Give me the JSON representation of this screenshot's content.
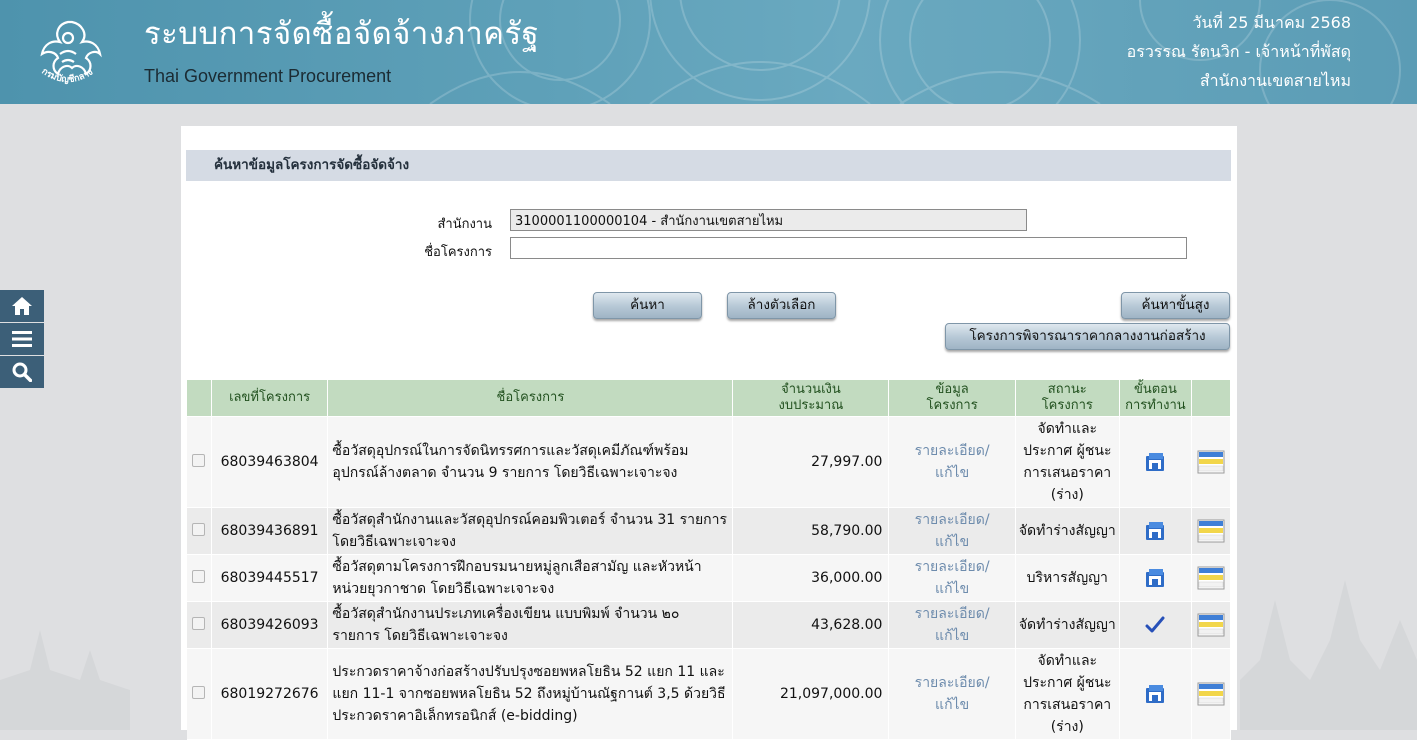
{
  "header": {
    "title_th": "ระบบการจัดซื้อจัดจ้างภาครัฐ",
    "title_en": "Thai Government Procurement",
    "date": "วันที่ 25 มีนาคม 2568",
    "user": "อรวรรณ รัตนวิก - เจ้าหน้าที่พัสดุ",
    "office": "สำนักงานเขตสายไหม",
    "logo_text": "กรมบัญชีกลาง"
  },
  "sidenav": [
    "home-icon",
    "menu-icon",
    "search-icon"
  ],
  "search": {
    "section_title": "ค้นหาข้อมูลโครงการจัดซื้อจัดจ้าง",
    "office_label": "สำนักงาน",
    "office_value": "3100001100000104 - สำนักงานเขตสายไหม",
    "project_label": "ชื่อโครงการ",
    "project_value": "",
    "search_button": "ค้นหา",
    "clear_button": "ล้างตัวเลือก",
    "advanced_button": "ค้นหาขั้นสูง",
    "median_price_button": "โครงการพิจารณาราคากลางงานก่อสร้าง"
  },
  "table": {
    "headers": {
      "number": "เลขที่โครงการ",
      "name": "ชื่อโครงการ",
      "budget_1": "จำนวนเงิน",
      "budget_2": "งบประมาณ",
      "info_1": "ข้อมูล",
      "info_2": "โครงการ",
      "status_1": "สถานะ",
      "status_2": "โครงการ",
      "step_1": "ขั้นตอน",
      "step_2": "การทำงาน"
    },
    "detail_link_1": "รายละเอียด/",
    "detail_link_2": "แก้ไข",
    "rows": [
      {
        "number": "68039463804",
        "name_1": " ซื้อวัสดุอุปกรณ์ในการจัดนิทรรศการและวัสดุเคมีภัณฑ์พร้อม",
        "name_2": "อุปกรณ์ล้างตลาด จำนวน 9 รายการ โดยวิธีเฉพาะเจาะจง",
        "name_3": "",
        "amount": "27,997.00",
        "status_1": "จัดทำและ",
        "status_2": "ประกาศ ผู้ชนะ",
        "status_3": "การเสนอราคา",
        "status_4": "(ร่าง)",
        "step_icon": "work-step-icon"
      },
      {
        "number": "68039436891",
        "name_1": " ซื้อวัสดุสำนักงานและวัสดุอุปกรณ์คอมพิวเตอร์ จำนวน 31 รายการ",
        "name_2": "โดยวิธีเฉพาะเจาะจง",
        "name_3": "",
        "amount": "58,790.00",
        "status_1": "จัดทำร่างสัญญา",
        "status_2": "",
        "status_3": "",
        "status_4": "",
        "step_icon": "work-step-icon"
      },
      {
        "number": "68039445517",
        "name_1": " ซื้อวัสดุตามโครงการฝึกอบรมนายหมู่ลูกเสือสามัญ และหัวหน้า",
        "name_2": "หน่วยยุวกาชาด โดยวิธีเฉพาะเจาะจง",
        "name_3": "",
        "amount": "36,000.00",
        "status_1": "บริหารสัญญา",
        "status_2": "",
        "status_3": "",
        "status_4": "",
        "step_icon": "work-step-icon"
      },
      {
        "number": "68039426093",
        "name_1": " ซื้อวัสดุสำนักงานประเภทเครื่องเขียน แบบพิมพ์ จำนวน ๒๐",
        "name_2": "รายการ โดยวิธีเฉพาะเจาะจง",
        "name_3": "",
        "amount": "43,628.00",
        "status_1": "จัดทำร่างสัญญา",
        "status_2": "",
        "status_3": "",
        "status_4": "",
        "step_icon": "checkmark-icon"
      },
      {
        "number": "68019272676",
        "name_1": " ประกวดราคาจ้างก่อสร้างปรับปรุงซอยพหลโยธิน 52 แยก 11 และ",
        "name_2": "แยก 11-1 จากซอยพหลโยธิน 52 ถึงหมู่บ้านณัฐกานต์ 3,5 ด้วยวิธี",
        "name_3": "ประกวดราคาอิเล็กทรอนิกส์ (e-bidding)",
        "amount": "21,097,000.00",
        "status_1": "จัดทำและ",
        "status_2": "ประกาศ ผู้ชนะ",
        "status_3": "การเสนอราคา",
        "status_4": "(ร่าง)",
        "step_icon": "work-step-icon"
      }
    ]
  },
  "colors": {
    "header_bg": "#5a9db6",
    "section_bg": "#d5dbe4",
    "table_header_bg": "#c2dbc0",
    "table_header_text": "#22511f",
    "link": "#6e8cad",
    "sidenav_bg": "#3c5f78"
  }
}
